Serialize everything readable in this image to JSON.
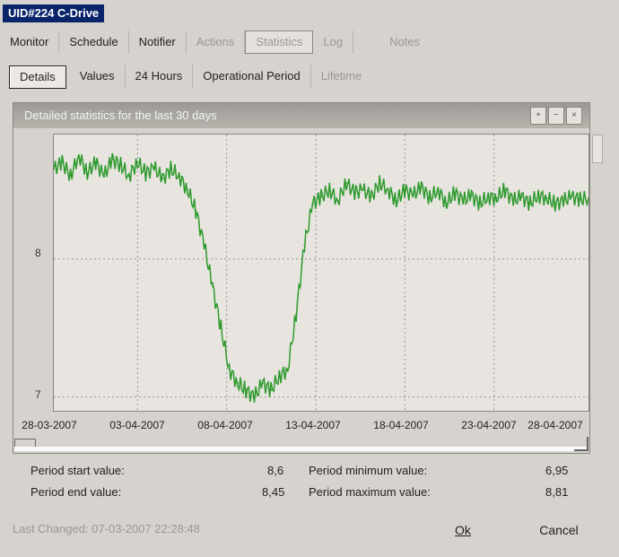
{
  "window": {
    "title": "UID#224 C-Drive"
  },
  "main_tabs": [
    {
      "label": "Monitor",
      "state": "normal"
    },
    {
      "label": "Schedule",
      "state": "normal"
    },
    {
      "label": "Notifier",
      "state": "normal"
    },
    {
      "label": "Actions",
      "state": "disabled"
    },
    {
      "label": "Statistics",
      "state": "active"
    },
    {
      "label": "Log",
      "state": "disabled"
    },
    {
      "label": "Notes",
      "state": "disabled"
    }
  ],
  "sub_tabs": [
    {
      "label": "Details",
      "state": "active"
    },
    {
      "label": "Values",
      "state": "normal"
    },
    {
      "label": "24 Hours",
      "state": "normal"
    },
    {
      "label": "Operational Period",
      "state": "normal"
    },
    {
      "label": "Lifetime",
      "state": "disabled"
    }
  ],
  "panel": {
    "title": "Detailed statistics for the last 30 days"
  },
  "chart_data": {
    "type": "line",
    "title": "",
    "xlabel": "",
    "ylabel": "",
    "yticks": [
      "7",
      "8"
    ],
    "ylim": [
      6.9,
      8.9
    ],
    "xticks": [
      "28-03-2007",
      "03-04-2007",
      "08-04-2007",
      "13-04-2007",
      "18-04-2007",
      "23-04-2007",
      "28-04-2007"
    ],
    "grid": true,
    "line_color": "#2e9a2e",
    "series": [
      {
        "name": "",
        "x_days": [
          0,
          0.5,
          1,
          1.5,
          2,
          2.5,
          3,
          3.5,
          4,
          4.5,
          5,
          5.5,
          6,
          6.5,
          7,
          7.5,
          8,
          8.5,
          9,
          9.5,
          10,
          10.5,
          11,
          11.5,
          12,
          12.5,
          13,
          13.5,
          14,
          14.5,
          15,
          15.5,
          16,
          16.5,
          17,
          17.5,
          18,
          18.5,
          19,
          19.5,
          20,
          20.5,
          21,
          21.5,
          22,
          22.5,
          23,
          23.5,
          24,
          24.5,
          25,
          25.5,
          26,
          26.5,
          27,
          27.5,
          28,
          28.5,
          29,
          29.5,
          30,
          30.5,
          31,
          31.5,
          32
        ],
        "values": [
          8.65,
          8.7,
          8.6,
          8.75,
          8.62,
          8.7,
          8.6,
          8.72,
          8.68,
          8.6,
          8.7,
          8.62,
          8.66,
          8.58,
          8.65,
          8.6,
          8.5,
          8.35,
          8.1,
          7.8,
          7.5,
          7.2,
          7.1,
          7.05,
          7.0,
          7.1,
          7.05,
          7.15,
          7.2,
          7.6,
          8.1,
          8.4,
          8.45,
          8.5,
          8.42,
          8.55,
          8.48,
          8.5,
          8.45,
          8.55,
          8.5,
          8.42,
          8.5,
          8.46,
          8.52,
          8.44,
          8.5,
          8.4,
          8.48,
          8.42,
          8.46,
          8.4,
          8.45,
          8.44,
          8.5,
          8.42,
          8.45,
          8.4,
          8.46,
          8.44,
          8.4,
          8.42,
          8.45,
          8.43,
          8.44
        ]
      }
    ]
  },
  "stats": {
    "start_label": "Period start value:",
    "start_value": "8,6",
    "end_label": "Period end value:",
    "end_value": "8,45",
    "min_label": "Period minimum value:",
    "min_value": "6,95",
    "max_label": "Period maximum value:",
    "max_value": "8,81"
  },
  "footer": {
    "last_changed": "Last Changed: 07-03-2007 22:28:48",
    "ok_label": "Ok",
    "cancel_label": "Cancel"
  }
}
